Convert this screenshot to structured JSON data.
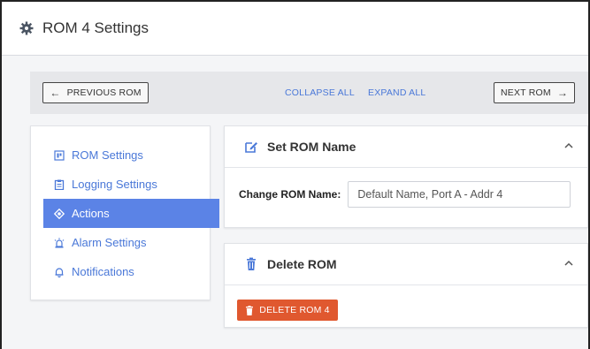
{
  "window": {
    "title": "ROM 4 Settings",
    "icon": "gear-icon"
  },
  "toolbar": {
    "prev_label": "PREVIOUS ROM",
    "collapse_all": "COLLAPSE ALL",
    "expand_all": "EXPAND ALL",
    "next_label": "NEXT ROM"
  },
  "sidebar": {
    "items": [
      {
        "label": "ROM Settings",
        "icon": "rom-chip-icon",
        "active": false
      },
      {
        "label": "Logging Settings",
        "icon": "clipboard-icon",
        "active": false
      },
      {
        "label": "Actions",
        "icon": "target-icon",
        "active": true
      },
      {
        "label": "Alarm Settings",
        "icon": "alarm-light-icon",
        "active": false
      },
      {
        "label": "Notifications",
        "icon": "bell-icon",
        "active": false
      }
    ]
  },
  "panels": {
    "set_name": {
      "title": "Set ROM Name",
      "icon": "edit-icon",
      "field_label": "Change ROM Name:",
      "field_value": "Default Name, Port A - Addr 4"
    },
    "delete": {
      "title": "Delete ROM",
      "icon": "trash-icon",
      "button_label": "DELETE ROM 4"
    }
  },
  "colors": {
    "accent": "#5b83e6",
    "link": "#4a78d8",
    "danger": "#e0582f",
    "background": "#f4f5f7"
  }
}
